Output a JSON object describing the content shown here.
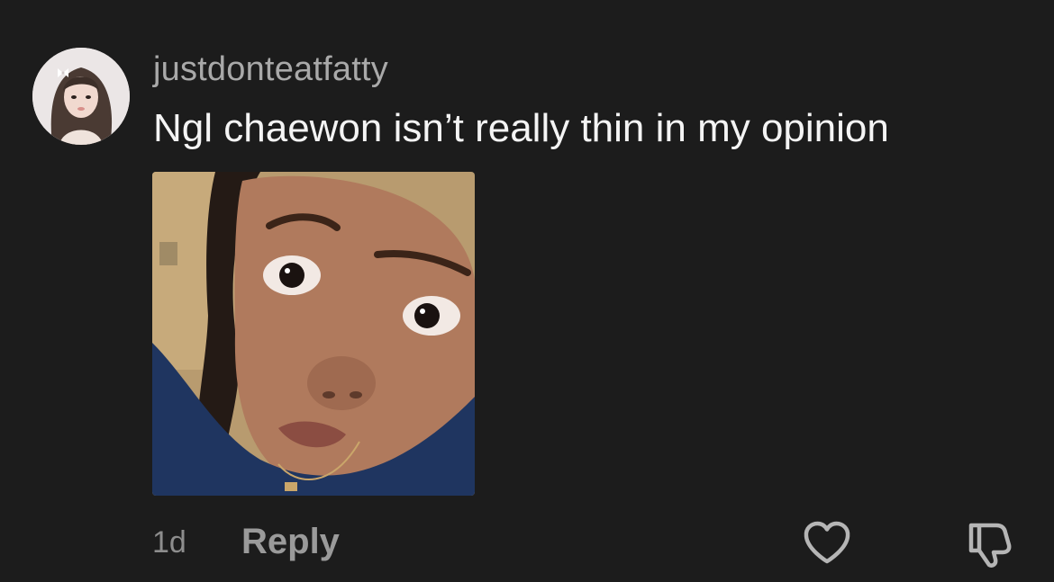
{
  "comment": {
    "username": "justdonteatfatty",
    "text": "Ngl chaewon isn’t really thin in my opinion",
    "timestamp": "1d",
    "reply_label": "Reply",
    "avatar_icon": "profile-photo",
    "attachment_icon": "selfie-photo"
  },
  "actions": {
    "like_icon": "heart-outline-icon",
    "dislike_icon": "thumbs-down-outline-icon"
  },
  "colors": {
    "background": "#1c1c1c",
    "username": "#a9a9a9",
    "text": "#f4f4f4",
    "muted": "#8d8d8d",
    "icon": "#b5b5b5"
  }
}
